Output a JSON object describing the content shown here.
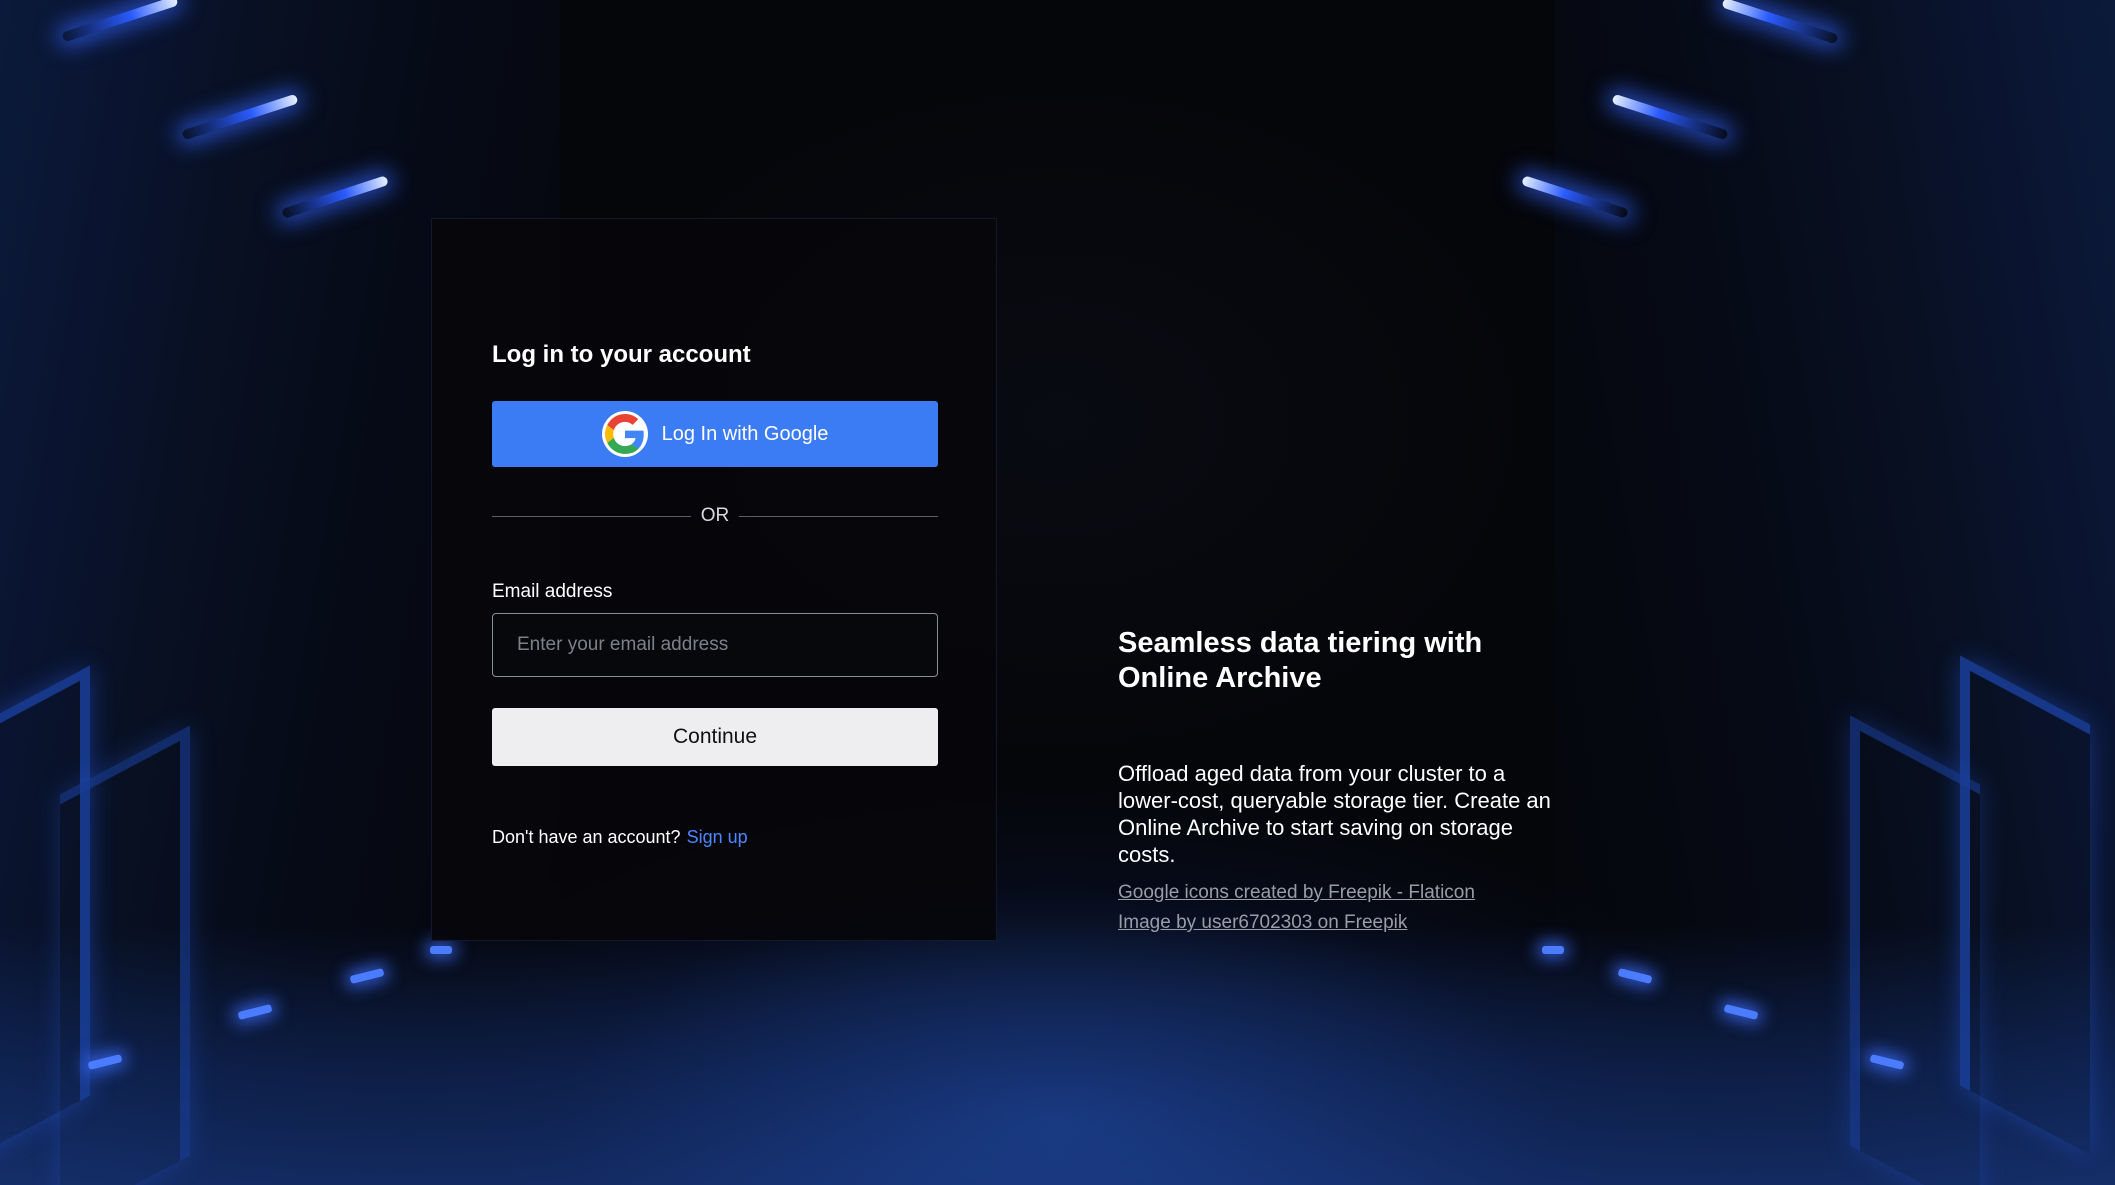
{
  "login": {
    "title": "Log in to your account",
    "google_button": "Log In with Google",
    "divider_text": "OR",
    "email_label": "Email address",
    "email_placeholder": "Enter your email address",
    "email_value": "",
    "continue_button": "Continue",
    "signup_prompt": "Don't have an account?",
    "signup_link": "Sign up"
  },
  "promo": {
    "title_line1": "Seamless data tiering with",
    "title_line2": "Online Archive",
    "body": "Offload aged data from your cluster to a lower-cost, queryable storage tier. Create an Online Archive to start saving on storage costs.",
    "credit_1": "Google icons created by Freepik - Flaticon",
    "credit_2": "Image by user6702303 on Freepik"
  },
  "colors": {
    "google_button_bg": "#3b7cf4",
    "link": "#4c86ff",
    "card_bg": "#06070b",
    "accent_glow": "#2a5bff"
  },
  "icons": {
    "google": "google-g-logo-icon"
  }
}
